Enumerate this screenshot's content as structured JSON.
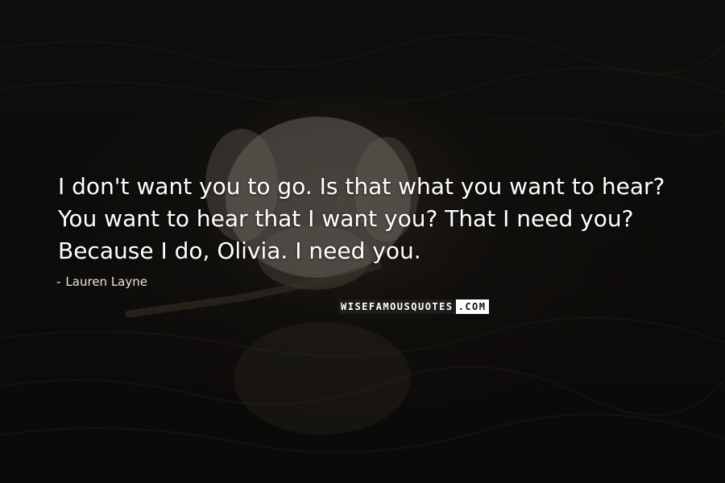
{
  "quote": {
    "text": "I don't want you to go. Is that what you want to hear? You want to hear that I want you? That I need you? Because I do, Olivia. I need you.",
    "author": "Lauren Layne",
    "author_prefix": "-"
  },
  "watermark": {
    "left": "WISEFAMOUSQUOTES",
    "right": ".COM"
  },
  "background": {
    "description_color": "#141210",
    "subject_color": "#cfc8bd"
  }
}
